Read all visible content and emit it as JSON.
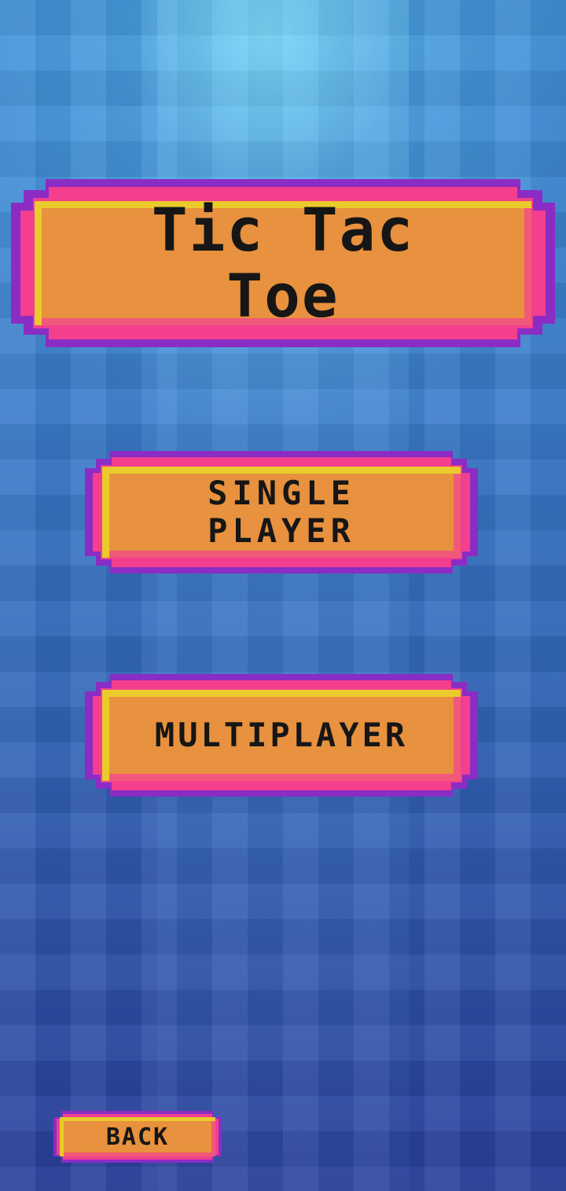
{
  "title": {
    "line1": "Tic Tac",
    "line2": "Toe"
  },
  "menu": {
    "single_player_line1": "SINGLE",
    "single_player_line2": "PLAYER",
    "multiplayer": "MULTIPLAYER",
    "back": "BACK"
  },
  "colors": {
    "button_fill": "#e8913e",
    "button_highlight": "#eacb2b",
    "button_shadow": "#f2587a",
    "button_border_pink": "#f33f8e",
    "button_border_purple": "#8b2cc4",
    "text": "#161616",
    "background_top": "#78d7f5",
    "background_bottom": "#2a3f9a"
  }
}
